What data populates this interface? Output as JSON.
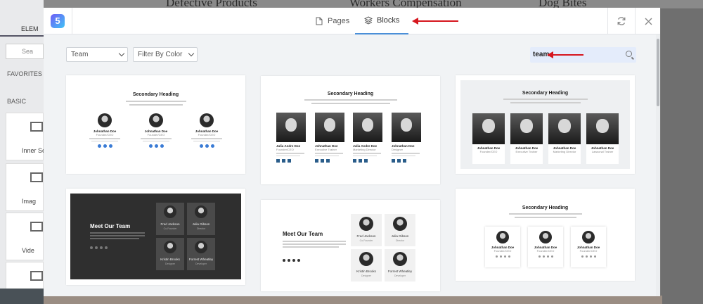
{
  "background": {
    "headings": [
      "Defective Products",
      "Workers Compensation",
      "Dog Bites"
    ],
    "sidebar": {
      "tab_label": "ELEM",
      "search_placeholder": "Sea",
      "favorites_label": "FAVORITES",
      "basic_label": "BASIC",
      "widgets": [
        "Inner Se",
        "Imag",
        "Vide"
      ]
    }
  },
  "header": {
    "logo_letter": "5",
    "tabs": [
      {
        "label": "Pages",
        "icon": "page-icon"
      },
      {
        "label": "Blocks",
        "icon": "layers-icon",
        "active": true
      }
    ],
    "sync_icon": "sync-icon",
    "close_icon": "close-icon"
  },
  "filters": {
    "category_value": "Team",
    "color_value": "Filter By Color",
    "search_value": "team"
  },
  "annotation_color": "#d6161e",
  "accent_color": "#4b8fd8",
  "blocks": [
    {
      "heading": "Secondary Heading",
      "members": [
        {
          "name": "Johnathan Doe",
          "role": "Founder/CEO"
        },
        {
          "name": "Johnathan Doe",
          "role": "Founder/CEO"
        },
        {
          "name": "Johnathan Doe",
          "role": "Founder/CEO"
        }
      ]
    },
    {
      "heading": "Secondary Heading",
      "members": [
        {
          "name": "Julia Andre Doe",
          "role": "Founder/CEO"
        },
        {
          "name": "Johnathan Doe",
          "role": "Executive Trainer"
        },
        {
          "name": "Julia Andre Doe",
          "role": "Marketing Director"
        },
        {
          "name": "Johnathan Doe",
          "role": "Designer"
        }
      ]
    },
    {
      "heading": "Secondary Heading",
      "members": [
        {
          "name": "Johnathan Doe",
          "role": "Founder/CEO"
        },
        {
          "name": "Johnathan Doe",
          "role": "Executive Trainer"
        },
        {
          "name": "Johnathan Doe",
          "role": "Marketing Director"
        },
        {
          "name": "Johnathan Doe",
          "role": "Lawsonal Trainer"
        }
      ]
    },
    {
      "heading": "Meet Our Team",
      "members": [
        {
          "name": "Fred Jackson",
          "role": "Co-Founder"
        },
        {
          "name": "Julia Gibson",
          "role": "Director"
        },
        {
          "name": "Kristin Brooks",
          "role": "Designer"
        },
        {
          "name": "Forrest Wheatley",
          "role": "Developer"
        }
      ]
    },
    {
      "heading": "Meet Our Team",
      "members": [
        {
          "name": "Fred Jackson",
          "role": "Co-Founder"
        },
        {
          "name": "Julia Gibson",
          "role": "Director"
        },
        {
          "name": "Kristin Brooks",
          "role": "Designer"
        },
        {
          "name": "Forrest Wheatley",
          "role": "Developer"
        }
      ]
    },
    {
      "heading": "Secondary Heading",
      "members": [
        {
          "name": "Johnathan Doe",
          "role": "Founder/CEO"
        },
        {
          "name": "Johnathan Doe",
          "role": "Founder/CEO"
        },
        {
          "name": "Johnathan Doe",
          "role": "Founder/CEO"
        }
      ]
    }
  ]
}
